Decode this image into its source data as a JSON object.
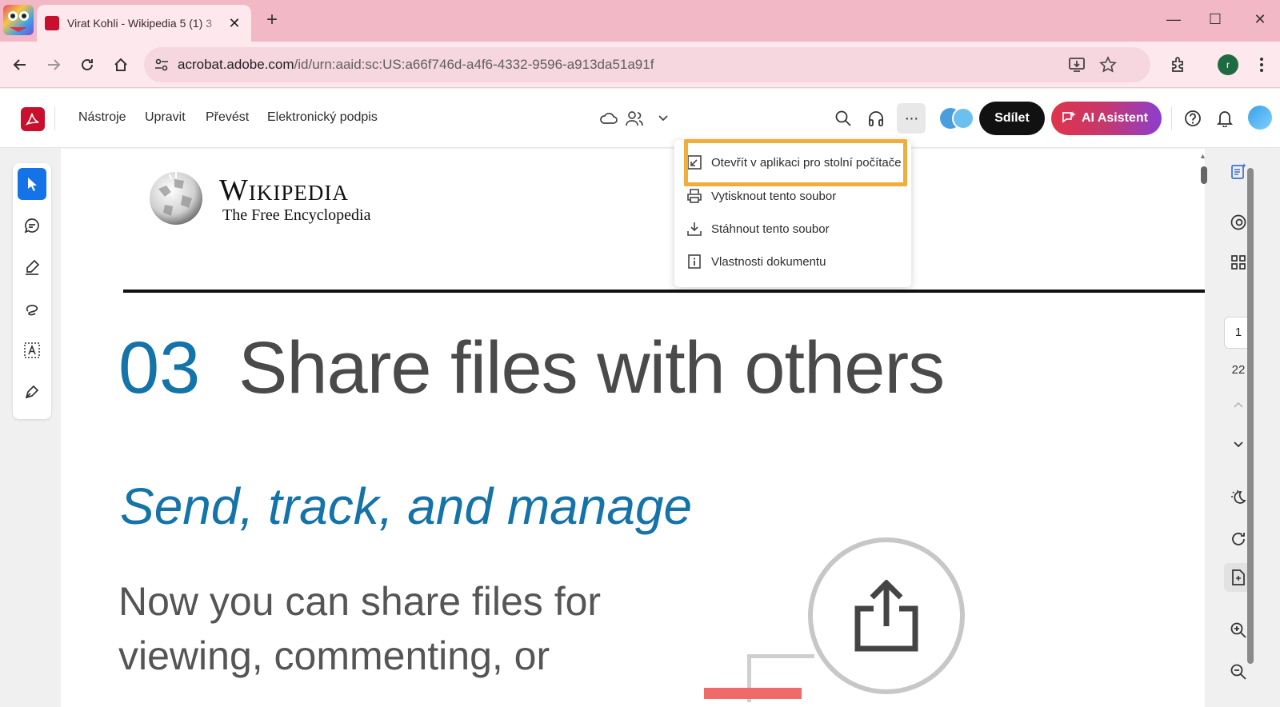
{
  "browser": {
    "tab_title": "Virat Kohli - Wikipedia 5 (1) 3",
    "tab_close": "✕",
    "new_tab": "+",
    "url_host": "acrobat.adobe.com",
    "url_path": "/id/urn:aaid:sc:US:a66f746d-a4f6-4332-9596-a913da51a91f",
    "profile_initial": "r",
    "win_minimize": "—",
    "win_maximize": "☐",
    "win_close": "✕"
  },
  "acrobat": {
    "menu": [
      "Nástroje",
      "Upravit",
      "Převést",
      "Elektronický podpis"
    ],
    "share_label": "Sdílet",
    "ai_label": "AI Asistent",
    "more_label": "···"
  },
  "dropdown": {
    "items": [
      {
        "label": "Otevřít v aplikaci pro stolní počítače",
        "icon": "open-external-icon"
      },
      {
        "label": "Vytisknout tento soubor",
        "icon": "print-icon"
      },
      {
        "label": "Stáhnout tento soubor",
        "icon": "download-icon"
      },
      {
        "label": "Vlastnosti dokumentu",
        "icon": "info-icon"
      }
    ],
    "highlight_color": "#f0ad3c"
  },
  "document": {
    "wiki_title": "Wikipedia",
    "wiki_tagline": "The Free Encyclopedia",
    "section_number": "03",
    "heading": "Share files with others",
    "subheading": "Send, track, and manage",
    "body_line1": "Now you can share files for",
    "body_line2": "viewing, commenting, or"
  },
  "pager": {
    "current_page": "1",
    "total_pages": "22"
  },
  "colors": {
    "accent": "#1473e6",
    "acrobat_red": "#c8102e",
    "doc_blue": "#1473a8",
    "browser_tint": "#f2b8c6"
  }
}
